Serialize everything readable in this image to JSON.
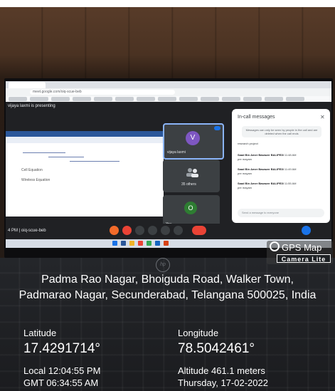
{
  "photo": {
    "browser": {
      "url": "meet.google.com/oiq-scue-beb"
    },
    "meeting": {
      "presenter_banner": "vijaya laxmi is presenting",
      "participants": {
        "self_tile_name": "vijaya laxmi",
        "self_avatar_letter": "V",
        "others_label": "35 others",
        "you_label": "You",
        "you_avatar_letter": "O"
      },
      "chat": {
        "title": "In-call messages",
        "info": "Messages can only be seen by people in the call and are deleted when the call ends",
        "messages": [
          {
            "text": "research project"
          },
          {
            "sender": "Saad Bin Amer Bawazer BALIPE3I",
            "time": "11:48 AM",
            "text": "pre mayam"
          },
          {
            "sender": "Saad Bin Amer Bawazer BALIPE3I",
            "time": "11:49 AM",
            "text": "pre mayam"
          },
          {
            "sender": "Saad Bin Amer Bawazer BALIPE3I",
            "time": "11:55 AM",
            "text": "pre mayam"
          }
        ],
        "input_placeholder": "Send a message to everyone"
      },
      "meeting_code": "4 PM | oiq-scue-beb"
    },
    "shared_doc": {
      "line1": "Cell Equation",
      "line2": "Wireless Equation"
    }
  },
  "gps_badge": {
    "title": "GPS Map",
    "subtitle": "Camera Lite"
  },
  "location": {
    "address": "Padma Rao Nagar, Bhoiguda Road, Walker Town, Padmarao Nagar, Secunderabad, Telangana 500025, India",
    "latitude_label": "Latitude",
    "latitude_value": "17.4291714°",
    "longitude_label": "Longitude",
    "longitude_value": "78.5042461°",
    "local_time": "Local 12:04:55 PM",
    "gmt_time": "GMT 06:34:55 AM",
    "altitude": "Altitude 461.1 meters",
    "date": "Thursday, 17-02-2022"
  },
  "colors": {
    "meet_accent": "#1a73e8",
    "end_call": "#ea4335",
    "overlay_text": "#ffffff"
  }
}
